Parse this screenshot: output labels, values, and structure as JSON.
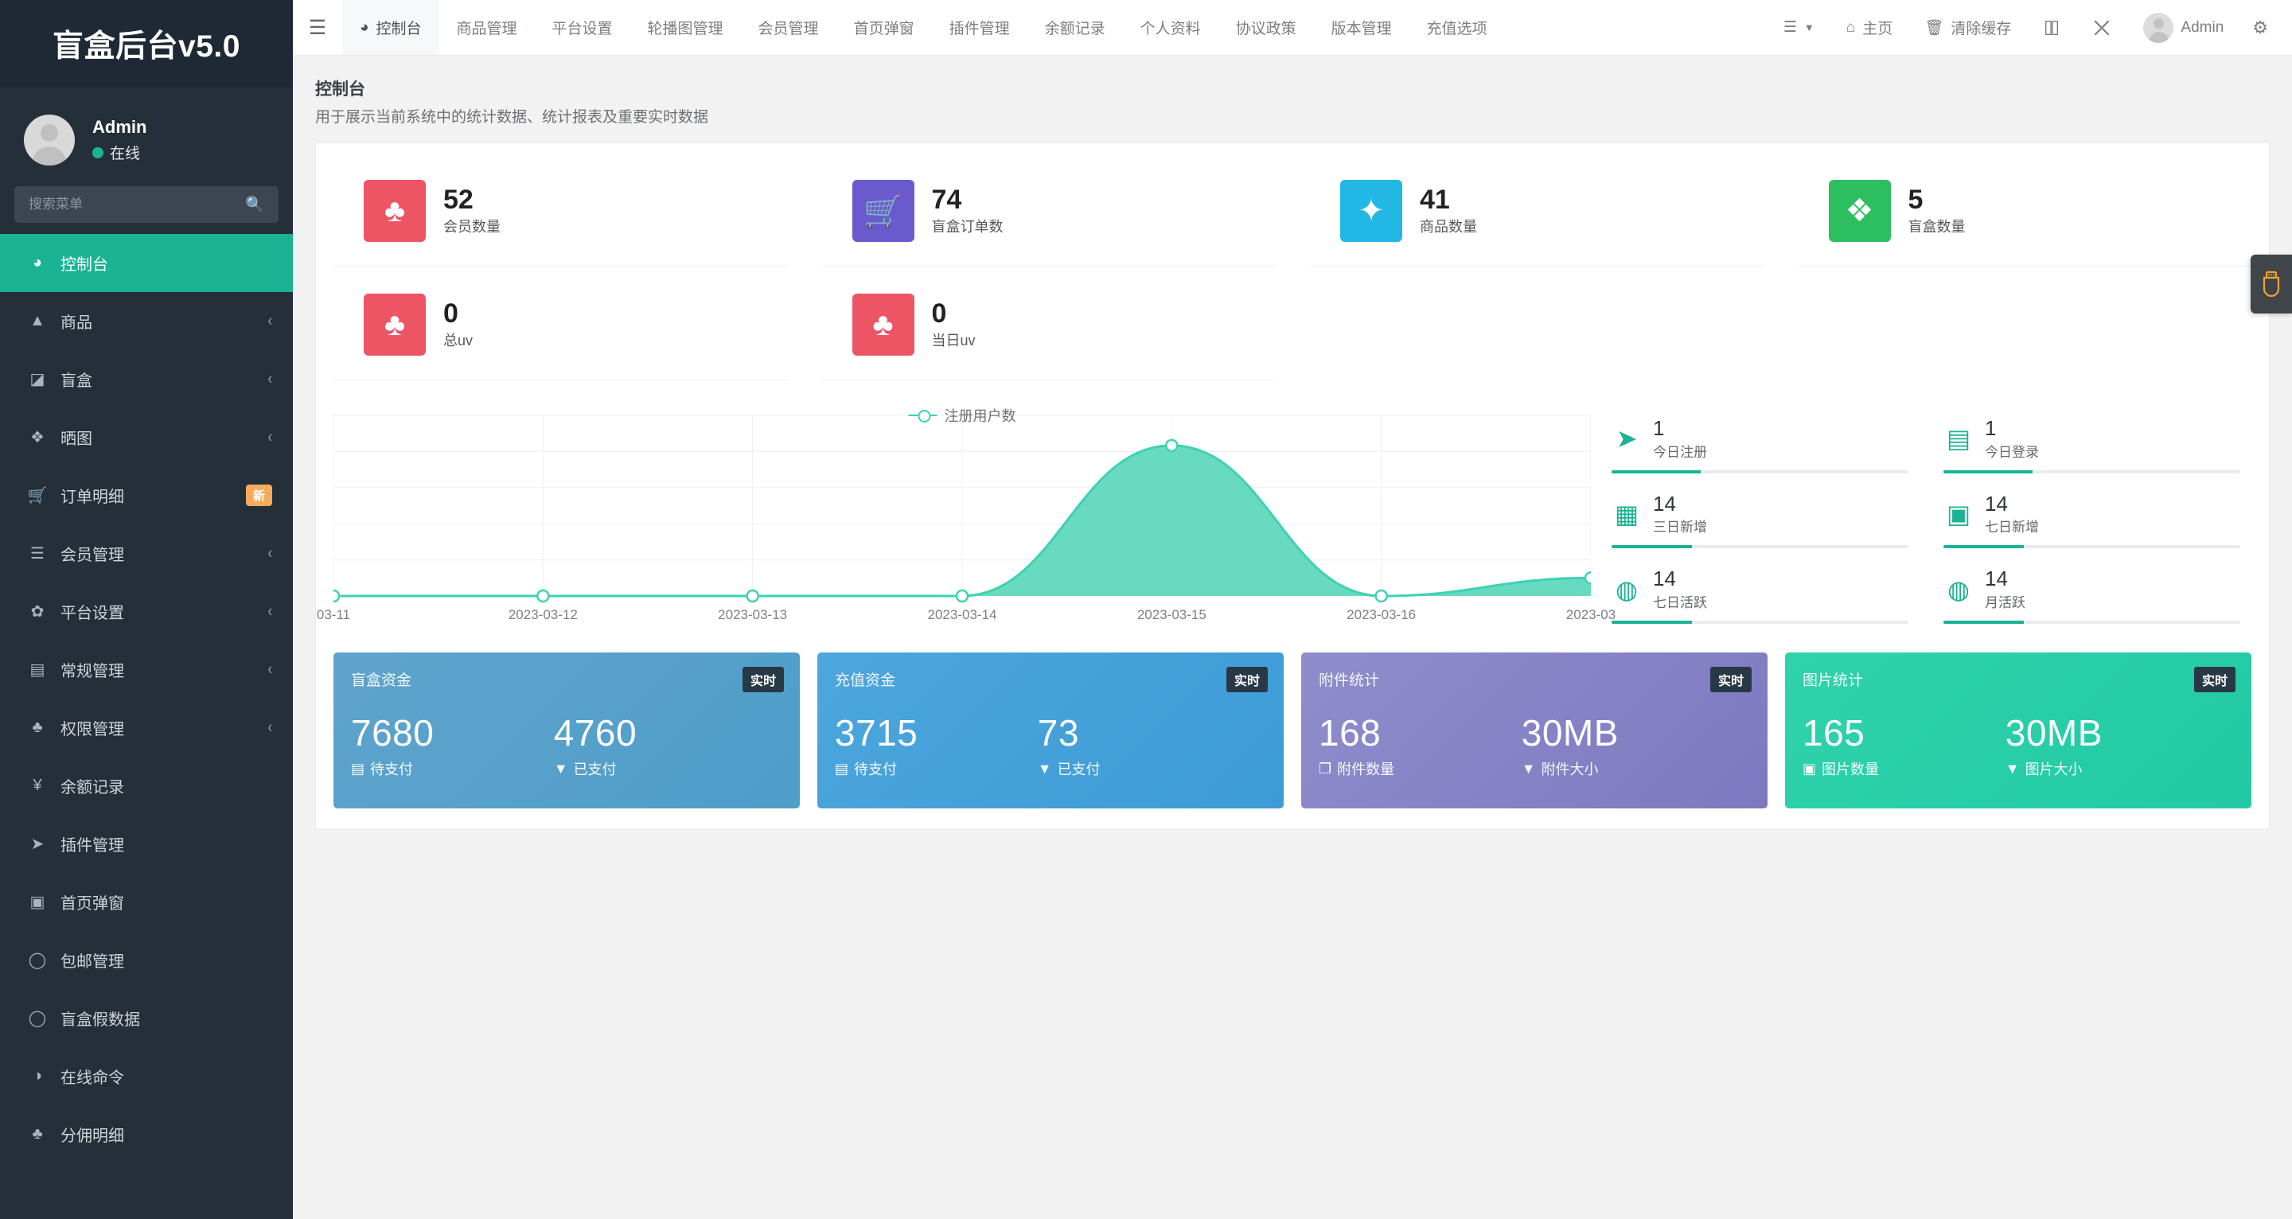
{
  "sidebar": {
    "logo": "盲盒后台v5.0",
    "user": {
      "name": "Admin",
      "status": "在线"
    },
    "search_placeholder": "搜索菜单",
    "items": [
      {
        "label": "控制台",
        "icon": "dashboard-icon",
        "active": true,
        "chevron": false,
        "badge": ""
      },
      {
        "label": "商品",
        "icon": "bag-icon",
        "active": false,
        "chevron": true,
        "badge": ""
      },
      {
        "label": "盲盒",
        "icon": "box-icon",
        "active": false,
        "chevron": true,
        "badge": ""
      },
      {
        "label": "晒图",
        "icon": "dropbox-icon",
        "active": false,
        "chevron": true,
        "badge": ""
      },
      {
        "label": "订单明细",
        "icon": "cart-icon",
        "active": false,
        "chevron": false,
        "badge": "新"
      },
      {
        "label": "会员管理",
        "icon": "list-icon",
        "active": false,
        "chevron": true,
        "badge": ""
      },
      {
        "label": "平台设置",
        "icon": "gear-icon",
        "active": false,
        "chevron": true,
        "badge": ""
      },
      {
        "label": "常规管理",
        "icon": "database-icon",
        "active": false,
        "chevron": true,
        "badge": ""
      },
      {
        "label": "权限管理",
        "icon": "users-icon",
        "active": false,
        "chevron": true,
        "badge": ""
      },
      {
        "label": "余额记录",
        "icon": "yen-icon",
        "active": false,
        "chevron": false,
        "badge": ""
      },
      {
        "label": "插件管理",
        "icon": "rocket-icon",
        "active": false,
        "chevron": false,
        "badge": ""
      },
      {
        "label": "首页弹窗",
        "icon": "image-icon",
        "active": false,
        "chevron": false,
        "badge": ""
      },
      {
        "label": "包邮管理",
        "icon": "circle-icon",
        "active": false,
        "chevron": false,
        "badge": ""
      },
      {
        "label": "盲盒假数据",
        "icon": "circle-icon",
        "active": false,
        "chevron": false,
        "badge": ""
      },
      {
        "label": "在线命令",
        "icon": "contrast-icon",
        "active": false,
        "chevron": false,
        "badge": ""
      },
      {
        "label": "分佣明细",
        "icon": "users-icon",
        "active": false,
        "chevron": false,
        "badge": ""
      }
    ]
  },
  "topbar": {
    "hamburger_icon": "hamburger-icon",
    "nav": [
      {
        "label": "控制台",
        "icon": "dashboard-icon",
        "active": true
      },
      {
        "label": "商品管理",
        "icon": "",
        "active": false
      },
      {
        "label": "平台设置",
        "icon": "",
        "active": false
      },
      {
        "label": "轮播图管理",
        "icon": "",
        "active": false
      },
      {
        "label": "会员管理",
        "icon": "",
        "active": false
      },
      {
        "label": "首页弹窗",
        "icon": "",
        "active": false
      },
      {
        "label": "插件管理",
        "icon": "",
        "active": false
      },
      {
        "label": "余额记录",
        "icon": "",
        "active": false
      },
      {
        "label": "个人资料",
        "icon": "",
        "active": false
      },
      {
        "label": "协议政策",
        "icon": "",
        "active": false
      },
      {
        "label": "版本管理",
        "icon": "",
        "active": false
      },
      {
        "label": "充值选项",
        "icon": "",
        "active": false
      }
    ],
    "right": {
      "menu_label": "",
      "home_label": "主页",
      "clear_cache_label": "清除缓存",
      "user_label": "Admin"
    }
  },
  "page": {
    "title": "控制台",
    "subtitle": "用于展示当前系统中的统计数据、统计报表及重要实时数据"
  },
  "stats": [
    {
      "value": "52",
      "label": "会员数量",
      "color": "#ed5565",
      "icon": "group-icon"
    },
    {
      "value": "74",
      "label": "盲盒订单数",
      "color": "#6a5acd",
      "icon": "cart-icon"
    },
    {
      "value": "41",
      "label": "商品数量",
      "color": "#23b7e5",
      "icon": "leaf-icon"
    },
    {
      "value": "5",
      "label": "盲盒数量",
      "color": "#2dbe60",
      "icon": "dropbox-icon"
    },
    {
      "value": "0",
      "label": "总uv",
      "color": "#ed5565",
      "icon": "group-icon"
    },
    {
      "value": "0",
      "label": "当日uv",
      "color": "#ed5565",
      "icon": "group-icon"
    }
  ],
  "chart_data": {
    "type": "area",
    "title": "",
    "legend": "注册用户数",
    "legend_position": "top-center",
    "grid": true,
    "xlabel": "",
    "ylabel": "",
    "ylim": [
      0,
      1.2
    ],
    "line_color": "#3fd1b4",
    "fill_color": "#56d6b9",
    "categories": [
      "03-11",
      "2023-03-12",
      "2023-03-13",
      "2023-03-14",
      "2023-03-15",
      "2023-03-16",
      "2023-03"
    ],
    "values": [
      0,
      0,
      0,
      0,
      1,
      0,
      0.12
    ]
  },
  "side_metrics": [
    {
      "value": "1",
      "label": "今日注册",
      "icon": "rocket-icon",
      "progress": 30
    },
    {
      "value": "1",
      "label": "今日登录",
      "icon": "id-card-icon",
      "progress": 30
    },
    {
      "value": "14",
      "label": "三日新增",
      "icon": "calendar-icon",
      "progress": 27
    },
    {
      "value": "14",
      "label": "七日新增",
      "icon": "calendar-plus-icon",
      "progress": 27
    },
    {
      "value": "14",
      "label": "七日活跃",
      "icon": "user-circle-icon",
      "progress": 27
    },
    {
      "value": "14",
      "label": "月活跃",
      "icon": "user-circle-icon",
      "progress": 27
    }
  ],
  "panels": [
    {
      "title": "盲盒资金",
      "tag": "实时",
      "color_start": "#5fa4cc",
      "color_end": "#4d9ec9",
      "left_value": "7680",
      "left_label": "待支付",
      "left_icon": "database-icon",
      "right_value": "4760",
      "right_label": "已支付",
      "right_icon": "filter-icon"
    },
    {
      "title": "充值资金",
      "tag": "实时",
      "color_start": "#4da6dd",
      "color_end": "#3d9bd6",
      "left_value": "3715",
      "left_label": "待支付",
      "left_icon": "database-icon",
      "right_value": "73",
      "right_label": "已支付",
      "right_icon": "filter-icon"
    },
    {
      "title": "附件统计",
      "tag": "实时",
      "color_start": "#8f8dcb",
      "color_end": "#7d79c0",
      "left_value": "168",
      "left_label": "附件数量",
      "left_icon": "attachment-icon",
      "right_value": "30MB",
      "right_label": "附件大小",
      "right_icon": "filter-icon"
    },
    {
      "title": "图片统计",
      "tag": "实时",
      "color_start": "#2fd3ab",
      "color_end": "#22c9a4",
      "left_value": "165",
      "left_label": "图片数量",
      "left_icon": "image-icon",
      "right_value": "30MB",
      "right_label": "图片大小",
      "right_icon": "filter-icon"
    }
  ],
  "side_tab": {
    "icon": "usb-icon",
    "color": "#f0a32e"
  }
}
